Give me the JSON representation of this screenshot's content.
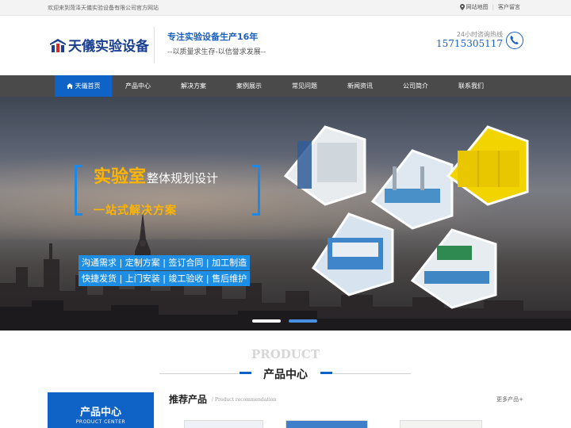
{
  "topbar": {
    "welcome": "欢迎来到菏泽天儀实验设备有限公司官方网站",
    "sitemap": "网站地图",
    "message": "客户留言"
  },
  "header": {
    "logo_text": "天儀实验设备",
    "slogan_main": "专注实验设备生产16年",
    "slogan_sub": "--以质量求生存-以信誉求发展--",
    "hotline_label": "24小时咨询热线",
    "hotline_number": "15715305117"
  },
  "nav": {
    "items": [
      {
        "label": "天儀首页",
        "active": true
      },
      {
        "label": "产品中心"
      },
      {
        "label": "解决方案"
      },
      {
        "label": "案例展示"
      },
      {
        "label": "常见问题"
      },
      {
        "label": "新闻资讯"
      },
      {
        "label": "公司简介"
      },
      {
        "label": "联系我们"
      }
    ]
  },
  "banner": {
    "title_big": "实验室",
    "title_rest": "整体规划设计",
    "subtitle": "一站式解决方案",
    "services_row1": "沟通需求 | 定制方案 | 签订合同 | 加工制造",
    "services_row2": "快捷发货 | 上门安装 | 竣工验收 | 售后维护",
    "slide_count": 2,
    "active_slide": 2
  },
  "product_section": {
    "title_en": "PRODUCT",
    "title_cn": "产品中心",
    "side_title": "产品中心",
    "side_sub": "PRODUCT CENTER",
    "rec_title": "推荐产品",
    "rec_sub": "/ Product recommendation",
    "more": "更多产品+"
  },
  "colors": {
    "brand_blue": "#0f62c6",
    "accent_orange": "#ffb400",
    "nav_bg": "#4a4a4a"
  }
}
